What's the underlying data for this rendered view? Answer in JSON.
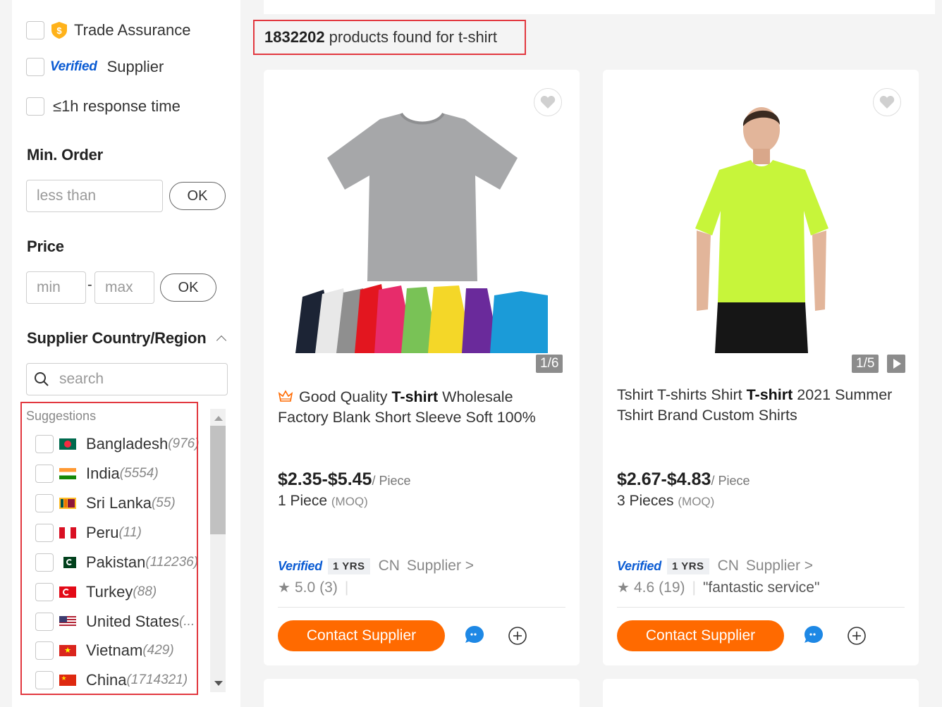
{
  "filters": {
    "trade_assurance": "Trade Assurance",
    "verified_badge": "Verified",
    "verified_supplier": "Supplier",
    "response_time": "≤1h response time",
    "min_order": {
      "title": "Min. Order",
      "placeholder": "less than",
      "ok": "OK"
    },
    "price": {
      "title": "Price",
      "min_placeholder": "min",
      "separator": "-",
      "max_placeholder": "max",
      "ok": "OK"
    },
    "country": {
      "title": "Supplier Country/Region",
      "search_placeholder": "search",
      "suggestions_label": "Suggestions",
      "items": [
        {
          "name": "Bangladesh",
          "count": "(976)",
          "flag": "bangladesh-flag-icon"
        },
        {
          "name": "India",
          "count": "(5554)",
          "flag": "india-flag-icon"
        },
        {
          "name": "Sri Lanka",
          "count": "(55)",
          "flag": "sri-lanka-flag-icon"
        },
        {
          "name": "Peru",
          "count": "(11)",
          "flag": "peru-flag-icon"
        },
        {
          "name": "Pakistan",
          "count": "(112236)",
          "flag": "pakistan-flag-icon"
        },
        {
          "name": "Turkey",
          "count": "(88)",
          "flag": "turkey-flag-icon"
        },
        {
          "name": "United States",
          "count": "(...",
          "flag": "us-flag-icon"
        },
        {
          "name": "Vietnam",
          "count": "(429)",
          "flag": "vietnam-flag-icon"
        },
        {
          "name": "China",
          "count": "(1714321)",
          "flag": "china-flag-icon"
        }
      ]
    }
  },
  "results": {
    "count": "1832202",
    "text": "products found for",
    "keyword": "t-shirt"
  },
  "products": [
    {
      "image_counter": "1/6",
      "title_pre": "Good Quality ",
      "title_bold": "T-shirt",
      "title_post": " Wholesale Factory Blank Short Sleeve Soft 100%",
      "price": "$2.35-$5.45",
      "unit": "/ Piece",
      "moq": "1 Piece",
      "moq_tag": "(MOQ)",
      "verified": "Verified",
      "years": "1 YRS",
      "country": "CN",
      "supplier_link": "Supplier >",
      "rating": "5.0",
      "reviews": "(3)",
      "review_quote": "",
      "contact": "Contact Supplier"
    },
    {
      "image_counter": "1/5",
      "title_pre": "Tshirt T-shirts Shirt ",
      "title_bold": "T-shirt",
      "title_post": " 2021 Summer Tshirt Brand Custom Shirts",
      "price": "$2.67-$4.83",
      "unit": "/ Piece",
      "moq": "3 Pieces",
      "moq_tag": "(MOQ)",
      "verified": "Verified",
      "years": "1 YRS",
      "country": "CN",
      "supplier_link": "Supplier >",
      "rating": "4.6",
      "reviews": "(19)",
      "review_quote": "\"fantastic service\"",
      "contact": "Contact Supplier"
    }
  ],
  "colors": {
    "accent": "#ff6a00",
    "highlight_border": "#e2383f",
    "verified_blue": "#0a5bd3"
  }
}
